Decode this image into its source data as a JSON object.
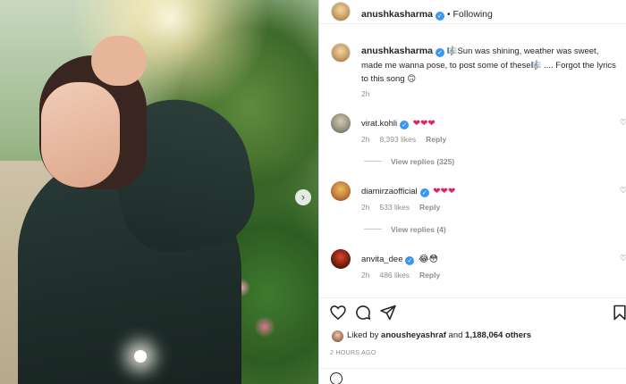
{
  "post": {
    "author": "anushkasharma",
    "follow_status": "Following",
    "separator": "•",
    "caption_text": "Sun was shining, weather was sweet, made me wanna pose, to post some of these",
    "caption_tail": ".... Forgot the lyrics to this song",
    "caption_emoji_1": "🎼",
    "caption_emoji_2": "🎼",
    "caption_emoji_3": "🙃",
    "caption_time": "2h"
  },
  "comments": [
    {
      "user": "virat.kohli",
      "text": "❤❤❤",
      "time": "2h",
      "likes": "8,393 likes",
      "reply": "Reply",
      "view_replies": "View replies (325)"
    },
    {
      "user": "diamirzaofficial",
      "text": "❤❤❤",
      "time": "2h",
      "likes": "533 likes",
      "reply": "Reply",
      "view_replies": "View replies (4)"
    },
    {
      "user": "anvita_dee",
      "text": "😂😳",
      "time": "2h",
      "likes": "486 likes",
      "reply": "Reply"
    }
  ],
  "likes_summary": {
    "prefix": "Liked by",
    "liker": "anousheyashraf",
    "and": "and",
    "others": "1,188,064 others"
  },
  "post_timestamp": "2 HOURS AGO",
  "icons": {
    "like": "heart-outline-icon",
    "comment": "comment-bubble-icon",
    "share": "paper-plane-icon",
    "save": "bookmark-icon",
    "verified": "verified-badge-icon",
    "next": "chevron-right-icon"
  },
  "colors": {
    "verified": "#3897f0",
    "heart": "#e0245e",
    "muted": "#8e8e8e",
    "text": "#262626"
  }
}
